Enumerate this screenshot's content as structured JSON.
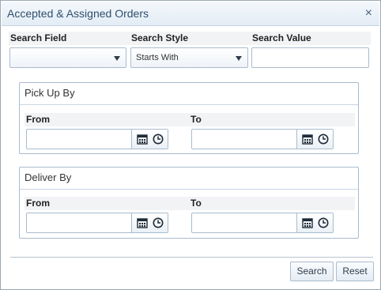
{
  "dialog": {
    "title": "Accepted & Assigned Orders",
    "close_glyph": "×"
  },
  "search": {
    "field_label": "Search Field",
    "field_value": "",
    "style_label": "Search Style",
    "style_value": "Starts With",
    "value_label": "Search Value",
    "value_text": ""
  },
  "pickup": {
    "title": "Pick Up By",
    "from_label": "From",
    "to_label": "To",
    "from_value": "",
    "to_value": ""
  },
  "deliver": {
    "title": "Deliver By",
    "from_label": "From",
    "to_label": "To",
    "from_value": "",
    "to_value": ""
  },
  "buttons": {
    "search": "Search",
    "reset": "Reset"
  },
  "icons": {
    "calendar": "calendar-icon",
    "clock": "clock-icon",
    "dropdown": "chevron-down-icon",
    "close": "close-icon"
  }
}
